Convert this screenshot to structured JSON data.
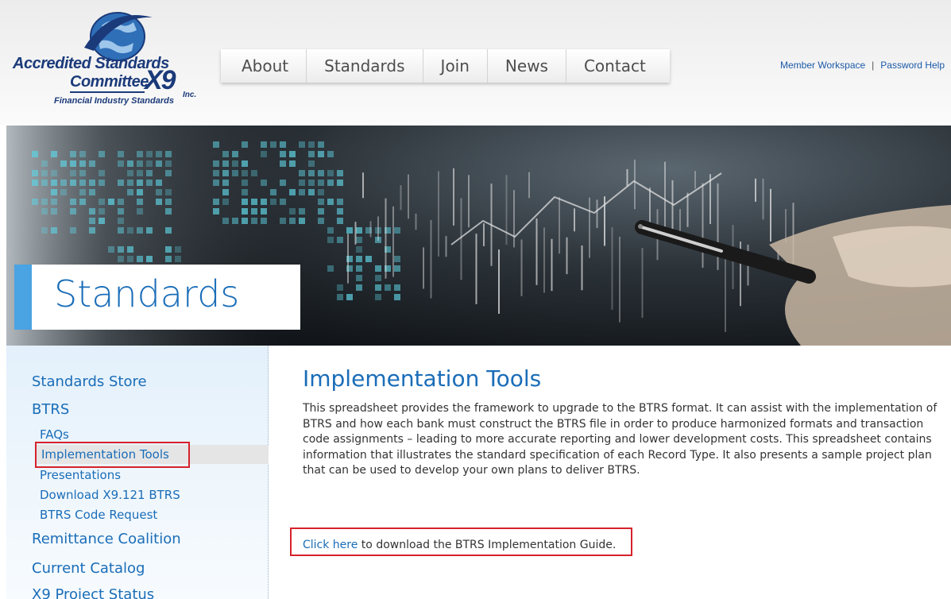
{
  "logo": {
    "line1": "Accredited Standards",
    "line2": "Committee",
    "x9": "X9",
    "inc": "Inc.",
    "tagline": "Financial Industry Standards"
  },
  "nav": {
    "items": [
      "About",
      "Standards",
      "Join",
      "News",
      "Contact"
    ]
  },
  "toplinks": {
    "workspace": "Member Workspace",
    "separator": "|",
    "password": "Password Help"
  },
  "hero": {
    "title": "Standards"
  },
  "sidebar": {
    "items": [
      {
        "label": "Standards Store"
      },
      {
        "label": "BTRS"
      },
      {
        "label": "FAQs"
      },
      {
        "label": "Implementation Tools",
        "active": true
      },
      {
        "label": "Presentations"
      },
      {
        "label": "Download X9.121 BTRS"
      },
      {
        "label": "BTRS Code Request"
      },
      {
        "label": "Remittance Coalition"
      },
      {
        "label": "Current Catalog"
      },
      {
        "label": "X9 Project Status"
      }
    ]
  },
  "content": {
    "heading": "Implementation Tools",
    "body": "This spreadsheet provides the framework to upgrade to the BTRS format. It can assist with the implementation of BTRS and how each bank must construct the BTRS file in order to produce harmonized formats and transaction code assignments – leading to more accurate reporting and lower development costs. This spreadsheet contains information that illustrates the standard specification of each Record Type. It also presents a sample project plan that can be used to develop your own plans to deliver BTRS.",
    "download_link": "Click here",
    "download_text": " to download the BTRS Implementation Guide."
  },
  "colors": {
    "link_blue": "#1a6db8",
    "highlight_red": "#d6222b",
    "hero_accent": "#4aa3e3"
  },
  "icons": [
    "globe-logo-icon"
  ]
}
